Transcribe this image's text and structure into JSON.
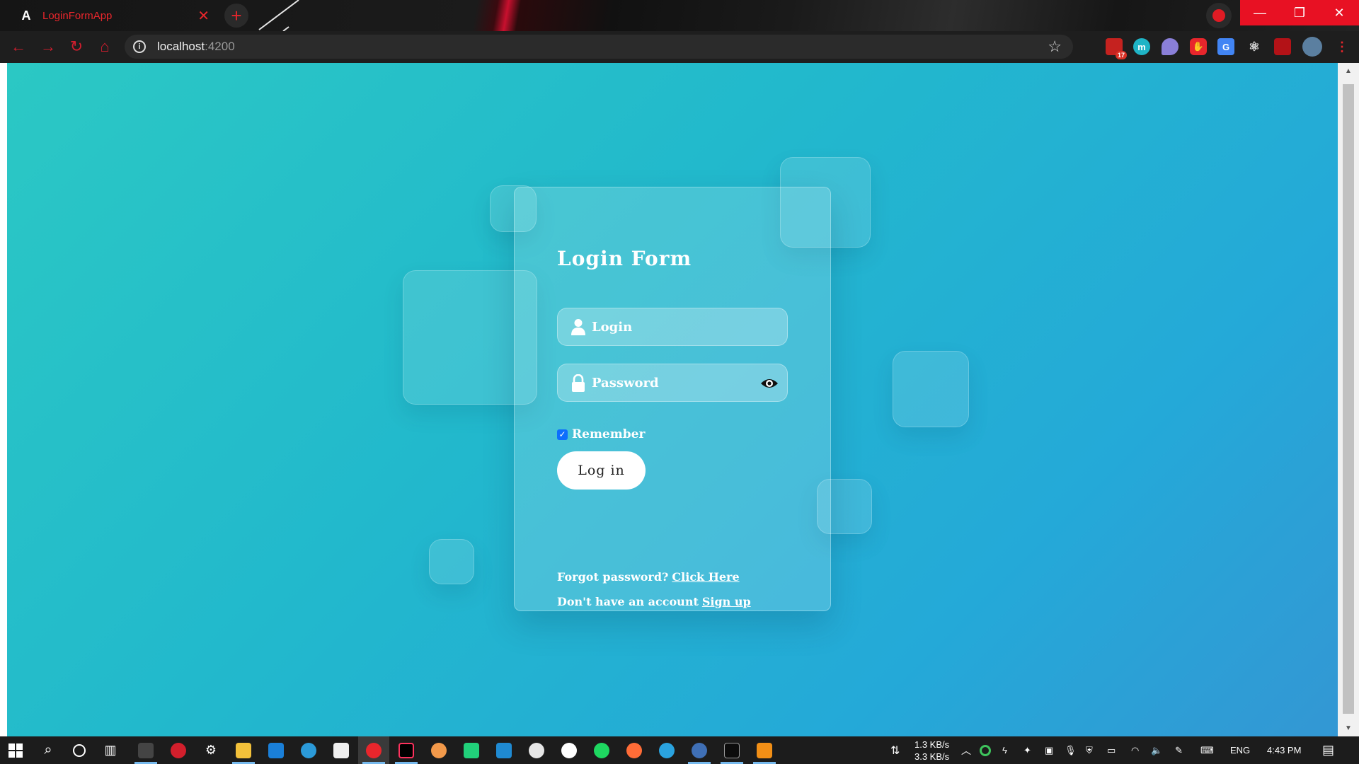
{
  "browser": {
    "tab_title": "LoginFormApp",
    "tab_favicon": "A",
    "new_tab_label": "+",
    "url_host": "localhost",
    "url_port": ":4200",
    "extension_badge_count": "17",
    "colors": {
      "accent": "#e8262c",
      "window_close": "#e81123"
    }
  },
  "page": {
    "title": "Login Form",
    "login_placeholder": "Login",
    "password_placeholder": "Password",
    "remember_label": "Remember",
    "remember_checked": true,
    "login_button": "Log in",
    "forgot_text": "Forgot password?",
    "forgot_link": "Click Here",
    "signup_text": "Don't have an account",
    "signup_link": "Sign up",
    "colors": {
      "gradient_start": "#2bc8c4",
      "gradient_end": "#3397d4",
      "checkbox": "#0d6efd"
    }
  },
  "taskbar": {
    "net_down": "1.3 KB/s",
    "net_up": "3.3 KB/s",
    "language": "ENG",
    "time": "4:43 PM"
  }
}
